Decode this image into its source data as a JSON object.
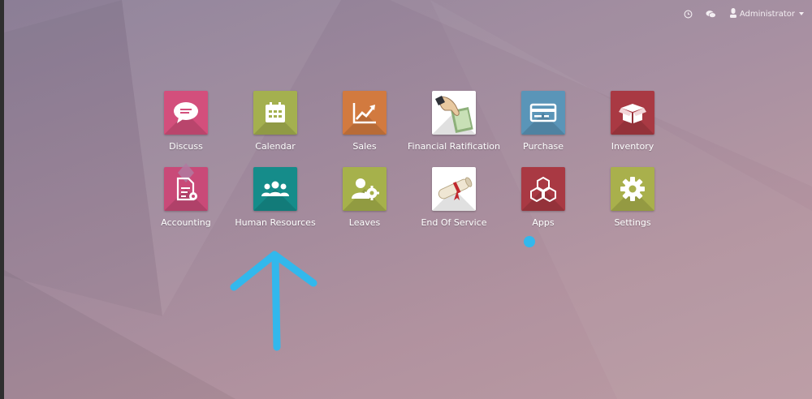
{
  "topbar": {
    "user_name": "Administrator",
    "icons": [
      "clock-icon",
      "chat-icon",
      "user-icon"
    ]
  },
  "apps": [
    {
      "label": "Discuss",
      "icon": "chat-bubble-icon",
      "color": "#d34f7c"
    },
    {
      "label": "Calendar",
      "icon": "calendar-icon",
      "color": "#a4b04f"
    },
    {
      "label": "Sales",
      "icon": "chart-trend-icon",
      "color": "#d27a3f"
    },
    {
      "label": "Financial Ratification",
      "icon": "hand-money-icon",
      "color": "#ffffff"
    },
    {
      "label": "Purchase",
      "icon": "credit-card-icon",
      "color": "#5a95b8"
    },
    {
      "label": "Inventory",
      "icon": "box-icon",
      "color": "#a93943"
    },
    {
      "label": "Accounting",
      "icon": "document-gear-icon",
      "color": "#c94a78"
    },
    {
      "label": "Human Resources",
      "icon": "people-group-icon",
      "color": "#158c8a"
    },
    {
      "label": "Leaves",
      "icon": "user-gear-icon",
      "color": "#a6b14b"
    },
    {
      "label": "End Of Service",
      "icon": "diploma-scroll-icon",
      "color": "#ffffff"
    },
    {
      "label": "Apps",
      "icon": "cubes-icon",
      "color": "#a93943"
    },
    {
      "label": "Settings",
      "icon": "gear-icon",
      "color": "#a9b04c"
    }
  ],
  "annotation_color": "#32b8ec"
}
